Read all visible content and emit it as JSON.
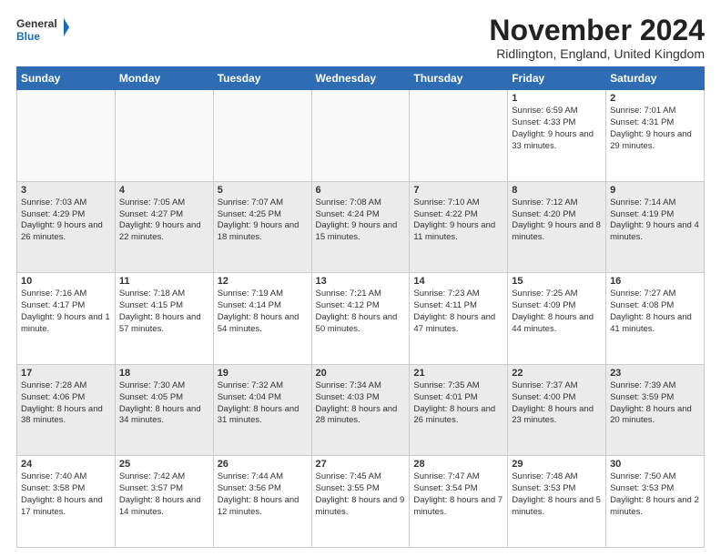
{
  "header": {
    "logo_general": "General",
    "logo_blue": "Blue",
    "month_title": "November 2024",
    "location": "Ridlington, England, United Kingdom"
  },
  "days_of_week": [
    "Sunday",
    "Monday",
    "Tuesday",
    "Wednesday",
    "Thursday",
    "Friday",
    "Saturday"
  ],
  "weeks": [
    [
      {
        "day": "",
        "info": ""
      },
      {
        "day": "",
        "info": ""
      },
      {
        "day": "",
        "info": ""
      },
      {
        "day": "",
        "info": ""
      },
      {
        "day": "",
        "info": ""
      },
      {
        "day": "1",
        "info": "Sunrise: 6:59 AM\nSunset: 4:33 PM\nDaylight: 9 hours and 33 minutes."
      },
      {
        "day": "2",
        "info": "Sunrise: 7:01 AM\nSunset: 4:31 PM\nDaylight: 9 hours and 29 minutes."
      }
    ],
    [
      {
        "day": "3",
        "info": "Sunrise: 7:03 AM\nSunset: 4:29 PM\nDaylight: 9 hours and 26 minutes."
      },
      {
        "day": "4",
        "info": "Sunrise: 7:05 AM\nSunset: 4:27 PM\nDaylight: 9 hours and 22 minutes."
      },
      {
        "day": "5",
        "info": "Sunrise: 7:07 AM\nSunset: 4:25 PM\nDaylight: 9 hours and 18 minutes."
      },
      {
        "day": "6",
        "info": "Sunrise: 7:08 AM\nSunset: 4:24 PM\nDaylight: 9 hours and 15 minutes."
      },
      {
        "day": "7",
        "info": "Sunrise: 7:10 AM\nSunset: 4:22 PM\nDaylight: 9 hours and 11 minutes."
      },
      {
        "day": "8",
        "info": "Sunrise: 7:12 AM\nSunset: 4:20 PM\nDaylight: 9 hours and 8 minutes."
      },
      {
        "day": "9",
        "info": "Sunrise: 7:14 AM\nSunset: 4:19 PM\nDaylight: 9 hours and 4 minutes."
      }
    ],
    [
      {
        "day": "10",
        "info": "Sunrise: 7:16 AM\nSunset: 4:17 PM\nDaylight: 9 hours and 1 minute."
      },
      {
        "day": "11",
        "info": "Sunrise: 7:18 AM\nSunset: 4:15 PM\nDaylight: 8 hours and 57 minutes."
      },
      {
        "day": "12",
        "info": "Sunrise: 7:19 AM\nSunset: 4:14 PM\nDaylight: 8 hours and 54 minutes."
      },
      {
        "day": "13",
        "info": "Sunrise: 7:21 AM\nSunset: 4:12 PM\nDaylight: 8 hours and 50 minutes."
      },
      {
        "day": "14",
        "info": "Sunrise: 7:23 AM\nSunset: 4:11 PM\nDaylight: 8 hours and 47 minutes."
      },
      {
        "day": "15",
        "info": "Sunrise: 7:25 AM\nSunset: 4:09 PM\nDaylight: 8 hours and 44 minutes."
      },
      {
        "day": "16",
        "info": "Sunrise: 7:27 AM\nSunset: 4:08 PM\nDaylight: 8 hours and 41 minutes."
      }
    ],
    [
      {
        "day": "17",
        "info": "Sunrise: 7:28 AM\nSunset: 4:06 PM\nDaylight: 8 hours and 38 minutes."
      },
      {
        "day": "18",
        "info": "Sunrise: 7:30 AM\nSunset: 4:05 PM\nDaylight: 8 hours and 34 minutes."
      },
      {
        "day": "19",
        "info": "Sunrise: 7:32 AM\nSunset: 4:04 PM\nDaylight: 8 hours and 31 minutes."
      },
      {
        "day": "20",
        "info": "Sunrise: 7:34 AM\nSunset: 4:03 PM\nDaylight: 8 hours and 28 minutes."
      },
      {
        "day": "21",
        "info": "Sunrise: 7:35 AM\nSunset: 4:01 PM\nDaylight: 8 hours and 26 minutes."
      },
      {
        "day": "22",
        "info": "Sunrise: 7:37 AM\nSunset: 4:00 PM\nDaylight: 8 hours and 23 minutes."
      },
      {
        "day": "23",
        "info": "Sunrise: 7:39 AM\nSunset: 3:59 PM\nDaylight: 8 hours and 20 minutes."
      }
    ],
    [
      {
        "day": "24",
        "info": "Sunrise: 7:40 AM\nSunset: 3:58 PM\nDaylight: 8 hours and 17 minutes."
      },
      {
        "day": "25",
        "info": "Sunrise: 7:42 AM\nSunset: 3:57 PM\nDaylight: 8 hours and 14 minutes."
      },
      {
        "day": "26",
        "info": "Sunrise: 7:44 AM\nSunset: 3:56 PM\nDaylight: 8 hours and 12 minutes."
      },
      {
        "day": "27",
        "info": "Sunrise: 7:45 AM\nSunset: 3:55 PM\nDaylight: 8 hours and 9 minutes."
      },
      {
        "day": "28",
        "info": "Sunrise: 7:47 AM\nSunset: 3:54 PM\nDaylight: 8 hours and 7 minutes."
      },
      {
        "day": "29",
        "info": "Sunrise: 7:48 AM\nSunset: 3:53 PM\nDaylight: 8 hours and 5 minutes."
      },
      {
        "day": "30",
        "info": "Sunrise: 7:50 AM\nSunset: 3:53 PM\nDaylight: 8 hours and 2 minutes."
      }
    ]
  ]
}
